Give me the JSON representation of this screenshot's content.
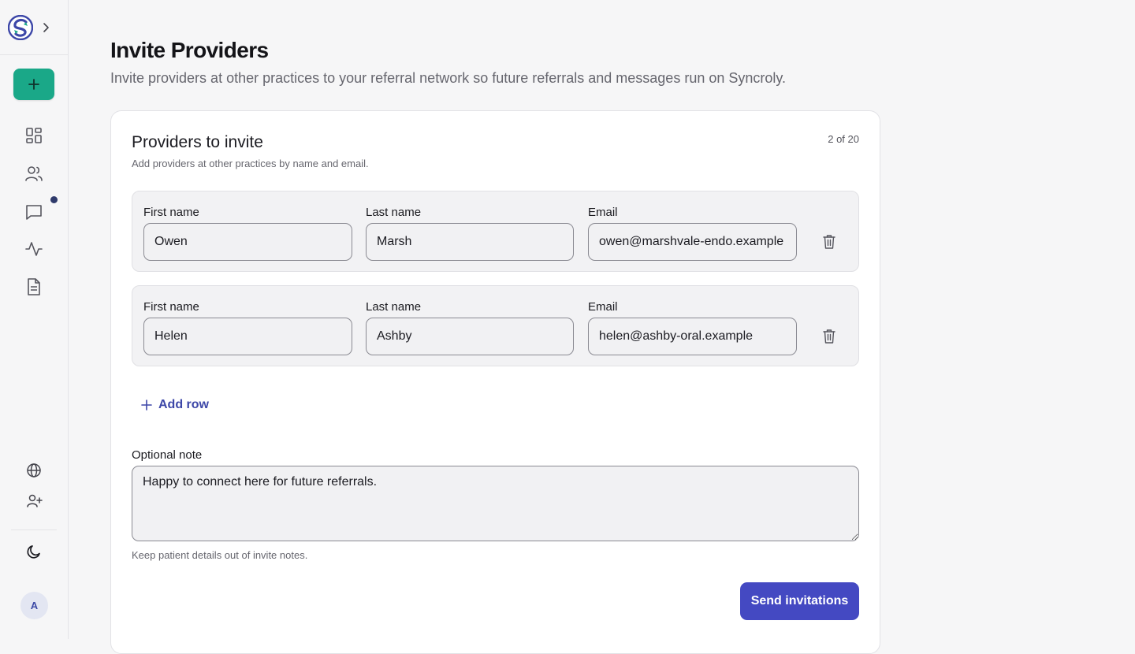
{
  "sidebar": {
    "logo": "syncroly-logo",
    "expand_icon": "chevron-right-icon",
    "new_icon": "plus-icon",
    "nav": [
      {
        "icon": "dashboard-icon"
      },
      {
        "icon": "users-icon"
      },
      {
        "icon": "messages-icon",
        "has_unread": true
      },
      {
        "icon": "activity-icon"
      },
      {
        "icon": "document-icon"
      }
    ],
    "bottom": [
      {
        "icon": "globe-icon"
      },
      {
        "icon": "user-plus-icon"
      },
      {
        "icon": "moon-icon"
      }
    ],
    "avatar_initial": "A"
  },
  "header": {
    "title": "Invite Providers",
    "subtitle": "Invite providers at other practices to your referral network so future referrals and messages run on Syncroly."
  },
  "card": {
    "title": "Providers to invite",
    "subtitle": "Add providers at other practices by name and email.",
    "counter": "2 of 20",
    "rows": [
      {
        "first_label": "First name",
        "first_value": "Owen",
        "last_label": "Last name",
        "last_value": "Marsh",
        "email_label": "Email",
        "email_value": "owen@marshvale-endo.example"
      },
      {
        "first_label": "First name",
        "first_value": "Helen",
        "last_label": "Last name",
        "last_value": "Ashby",
        "email_label": "Email",
        "email_value": "helen@ashby-oral.example"
      }
    ],
    "add_row_label": "Add row",
    "note_label": "Optional note",
    "note_value": "Happy to connect here for future referrals.",
    "note_hint": "Keep patient details out of invite notes.",
    "send_label": "Send invitations"
  },
  "colors": {
    "accent": "#4449c2",
    "new_button": "#1aa888",
    "unread_dot": "#2f3a6b"
  }
}
